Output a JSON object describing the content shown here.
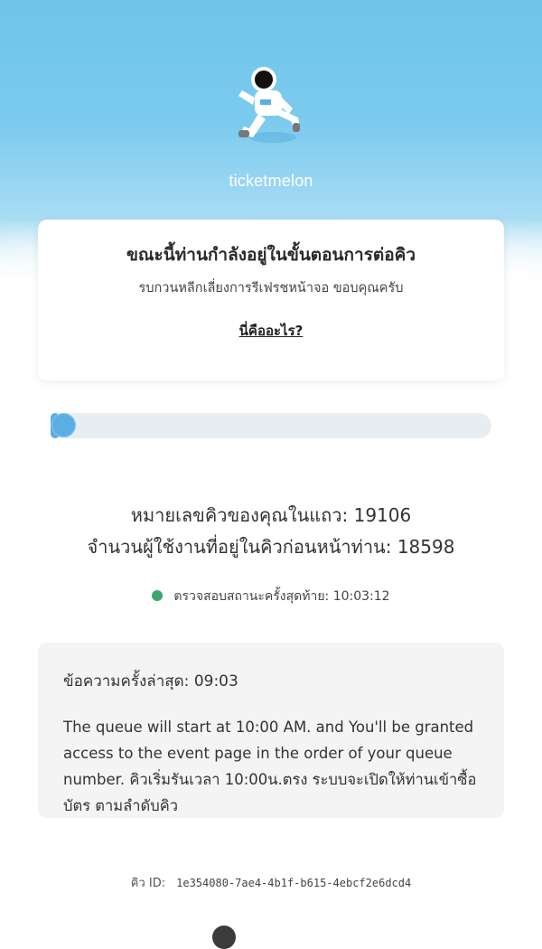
{
  "brand": {
    "name": "ticketmelon"
  },
  "notice": {
    "title": "ขณะนี้ท่านกำลังอยู่ในขั้นตอนการต่อคิว",
    "subtitle": "รบกวนหลีกเลี่ยงการรีเฟรชหน้าจอ ขอบคุณครับ",
    "link": "นี่คืออะไร?"
  },
  "progress": {
    "fraction": 0.02
  },
  "queue": {
    "number_line": "หมายเลขคิวของคุณในแถว: 19106",
    "ahead_line": "จำนวนผู้ใช้งานที่อยู่ในคิวก่อนหน้าท่าน: 18598"
  },
  "status": {
    "text": "ตรวจสอบสถานะครั้งสุดท้าย: 10:03:12",
    "dot_color": "#3fa66b"
  },
  "message": {
    "heading": "ข้อความครั้งล่าสุด: 09:03",
    "body": "The queue will start at 10:00 AM. and You'll be granted access to the event page in the order of your queue number. คิวเริ่มรันเวลา 10:00น.ตรง ระบบจะเปิดให้ท่านเข้าซื้อบัตร ตามลำดับคิว"
  },
  "queue_id": {
    "label": "คิว ID:",
    "value": "1e354080-7ae4-4b1f-b615-4ebcf2e6dcd4"
  },
  "colors": {
    "sky": "#7ccbee",
    "accent": "#5aaee4"
  }
}
